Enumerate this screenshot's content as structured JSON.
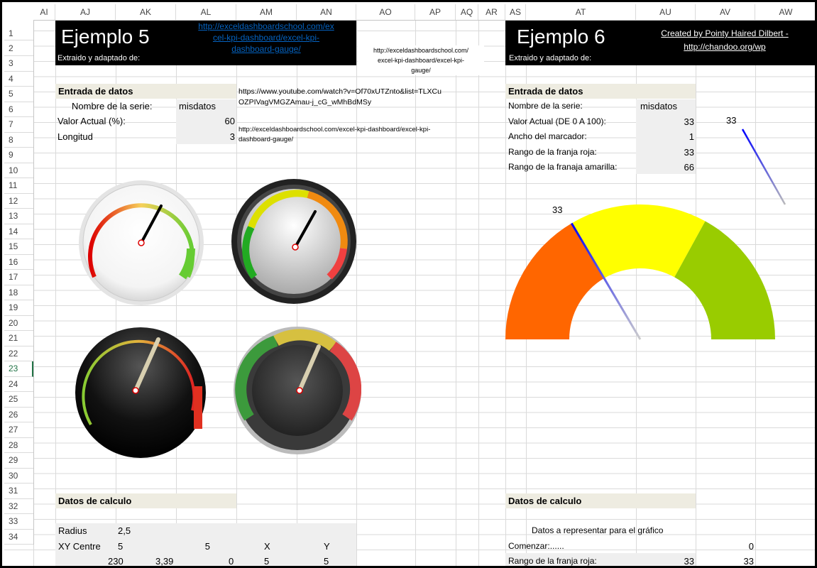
{
  "columns": [
    "AI",
    "AJ",
    "AK",
    "AL",
    "AM",
    "AN",
    "AO",
    "AP",
    "AQ",
    "AR",
    "AS",
    "AT",
    "AU",
    "AV",
    "AW"
  ],
  "rows": [
    "1",
    "2",
    "3",
    "4",
    "5",
    "6",
    "7",
    "8",
    "9",
    "10",
    "11",
    "12",
    "13",
    "14",
    "15",
    "16",
    "17",
    "18",
    "19",
    "20",
    "21",
    "22",
    "23",
    "24",
    "25",
    "26",
    "27",
    "28",
    "29",
    "30",
    "31",
    "32",
    "33",
    "34"
  ],
  "selected_row": "23",
  "left": {
    "title": "Ejemplo 5",
    "subtitle": "Extraido y adaptado de:",
    "link_lines": [
      "http://exceldashboardschool.com/ex",
      "cel-kpi-dashboard/excel-kpi-",
      "dashboard-gauge/"
    ],
    "url_small": [
      "http://exceldashboardschool.com/",
      "excel-kpi-dashboard/excel-kpi-",
      "gauge/"
    ],
    "entrada": "Entrada de datos",
    "serie_label": "Nombre de la serie:",
    "serie_value": "misdatos",
    "valor_label": "Valor Actual (%):",
    "valor_value": "60",
    "long_label": "Longitud",
    "long_value": "3",
    "youtube": [
      "https://www.youtube.com/watch?v=Of70xUTZnto&list=TLXCu",
      "OZPIVagVMGZAmau-j_cG_wMhBdMSy"
    ],
    "url2": [
      "http://exceldashboardschool.com/excel-kpi-dashboard/excel-kpi-",
      "dashboard-gauge/"
    ],
    "calc": "Datos de calculo",
    "radius_label": "Radius",
    "radius_value": "2,5",
    "xy_label": "XY Centre",
    "xy_v1": "5",
    "xy_v2": "5",
    "xy_x": "X",
    "xy_y": "Y",
    "r34": [
      "230",
      "3,39",
      "0",
      "5",
      "5"
    ]
  },
  "right": {
    "title": "Ejemplo 6",
    "subtitle": "Extraido y adaptado de:",
    "credit": [
      "Created by Pointy Haired Dilbert -",
      "http://chandoo.org/wp"
    ],
    "entrada": "Entrada de datos",
    "rows": [
      {
        "label": "Nombre de la serie:",
        "value": "misdatos"
      },
      {
        "label": "Valor Actual (DE 0 A 100):",
        "value": "33"
      },
      {
        "label": "Ancho del marcador:",
        "value": "1"
      },
      {
        "label": "Rango de la franja roja:",
        "value": "33"
      },
      {
        "label": "Rango de la franaja amarilla:",
        "value": "66"
      }
    ],
    "gauge_value_label": "33",
    "mini_value_label": "33",
    "calc": "Datos de calculo",
    "datos_rep": "Datos a representar para el gráfico",
    "comenzar": "Comenzar:......",
    "comenzar_value": "0",
    "rango_roja": "Rango de la franja roja:",
    "rango_roja_v1": "33",
    "rango_roja_v2": "33"
  },
  "gauge": {
    "value": 33,
    "red_end": 33,
    "yellow_end": 66,
    "max": 100,
    "colors": {
      "red": "#ff6600",
      "yellow": "#ffff00",
      "green": "#99cc00",
      "needle": "#0000ff"
    }
  }
}
